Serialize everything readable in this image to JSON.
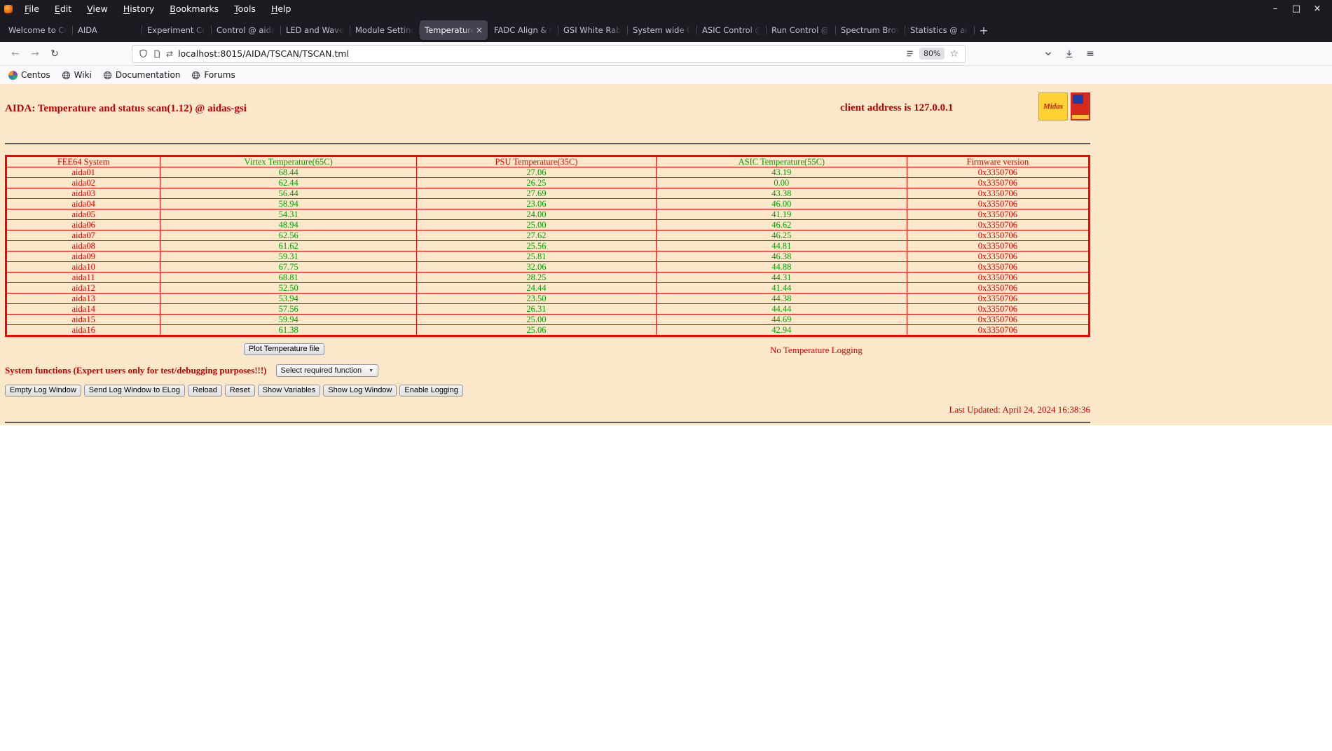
{
  "browser": {
    "menus": [
      "File",
      "Edit",
      "View",
      "History",
      "Bookmarks",
      "Tools",
      "Help"
    ],
    "tabs": [
      {
        "label": "Welcome to Cent",
        "active": false
      },
      {
        "label": "AIDA",
        "active": false
      },
      {
        "label": "Experiment Cont",
        "active": false
      },
      {
        "label": "Control @ aidas-",
        "active": false
      },
      {
        "label": "LED and Wavefor",
        "active": false
      },
      {
        "label": "Module Settings",
        "active": false
      },
      {
        "label": "Temperature an",
        "active": true
      },
      {
        "label": "FADC Align & Co",
        "active": false
      },
      {
        "label": "GSI White Rabbit",
        "active": false
      },
      {
        "label": "System wide Che",
        "active": false
      },
      {
        "label": "ASIC Control @ a",
        "active": false
      },
      {
        "label": "Run Control @ ai",
        "active": false
      },
      {
        "label": "Spectrum Brows",
        "active": false
      },
      {
        "label": "Statistics @ aida",
        "active": false
      }
    ],
    "bookmarks": [
      "Centos",
      "Wiki",
      "Documentation",
      "Forums"
    ],
    "nav": {
      "url": "localhost:8015/AIDA/TSCAN/TSCAN.tml",
      "zoom": "80%"
    },
    "icons": {
      "minimize": "–",
      "maximize": "□",
      "close_window": "×",
      "tab_close": "×",
      "new_tab": "+",
      "back": "←",
      "forward": "→",
      "reload": "↻",
      "https_arrows": "⇄",
      "star": "☆",
      "menu": "≡",
      "select_arrow": "▼"
    }
  },
  "page": {
    "title": "AIDA: Temperature and status scan(1.12) @ aidas-gsi",
    "client_address": "client address is 127.0.0.1",
    "logos": {
      "midas": "Midas"
    },
    "table": {
      "headers": [
        "FEE64 System",
        "Virtex Temperature(65C)",
        "PSU Temperature(35C)",
        "ASIC Temperature(55C)",
        "Firmware version"
      ],
      "header_colors": [
        "#e00000",
        "#00a000",
        "#e00000",
        "#00a000",
        "#e00000"
      ],
      "cell_colors": [
        "#e00000",
        "#00a000",
        "#00a000",
        "#00a000",
        "#e00000"
      ],
      "rows": [
        [
          "aida01",
          "68.44",
          "27.06",
          "43.19",
          "0x3350706"
        ],
        [
          "aida02",
          "62.44",
          "26.25",
          "0.00",
          "0x3350706"
        ],
        [
          "aida03",
          "56.44",
          "27.69",
          "43.38",
          "0x3350706"
        ],
        [
          "aida04",
          "58.94",
          "23.06",
          "46.00",
          "0x3350706"
        ],
        [
          "aida05",
          "54.31",
          "24.00",
          "41.19",
          "0x3350706"
        ],
        [
          "aida06",
          "48.94",
          "25.00",
          "46.62",
          "0x3350706"
        ],
        [
          "aida07",
          "62.56",
          "27.62",
          "46.25",
          "0x3350706"
        ],
        [
          "aida08",
          "61.62",
          "25.56",
          "44.81",
          "0x3350706"
        ],
        [
          "aida09",
          "59.31",
          "25.81",
          "46.38",
          "0x3350706"
        ],
        [
          "aida10",
          "67.75",
          "32.06",
          "44.88",
          "0x3350706"
        ],
        [
          "aida11",
          "68.81",
          "28.25",
          "44.31",
          "0x3350706"
        ],
        [
          "aida12",
          "52.50",
          "24.44",
          "41.44",
          "0x3350706"
        ],
        [
          "aida13",
          "53.94",
          "23.50",
          "44.38",
          "0x3350706"
        ],
        [
          "aida14",
          "57.56",
          "26.31",
          "44.44",
          "0x3350706"
        ],
        [
          "aida15",
          "59.94",
          "25.00",
          "44.69",
          "0x3350706"
        ],
        [
          "aida16",
          "61.38",
          "25.06",
          "42.94",
          "0x3350706"
        ]
      ]
    },
    "plot_button": "Plot Temperature file",
    "logging_status": "No Temperature Logging",
    "system_functions_label": "System functions (Expert users only for test/debugging purposes!!!)",
    "select_placeholder": "Select required function",
    "action_buttons": [
      "Empty Log Window",
      "Send Log Window to ELog",
      "Reload",
      "Reset",
      "Show Variables",
      "Show Log Window",
      "Enable Logging"
    ],
    "last_updated": "Last Updated: April 24, 2024 16:38:36",
    "colors": {
      "page_bg": "#fbe8ca",
      "title_red": "#c00000",
      "table_red": "#e00000",
      "value_green": "#00a000",
      "table_border": "#ff0000"
    }
  }
}
